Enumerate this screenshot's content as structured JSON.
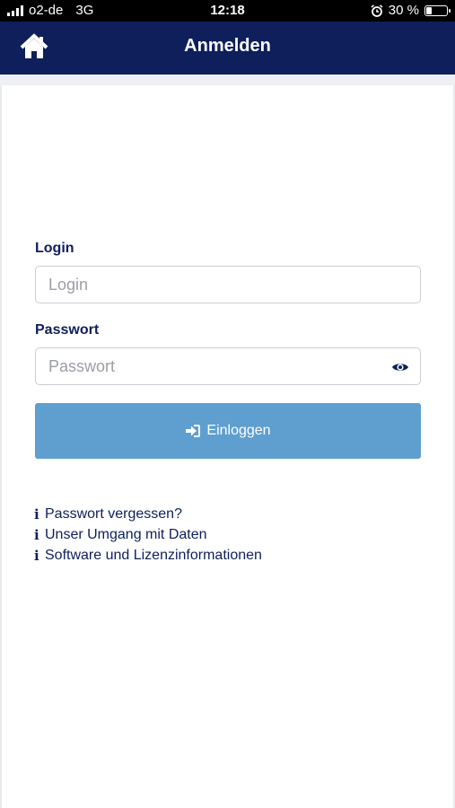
{
  "status_bar": {
    "carrier": "o2-de",
    "network": "3G",
    "time": "12:18",
    "battery": "30 %",
    "battery_level": 0.3
  },
  "header": {
    "title": "Anmelden",
    "home_icon": "home-icon",
    "color": "#0e1f5b"
  },
  "form": {
    "login_label": "Login",
    "login_placeholder": "Login",
    "password_label": "Passwort",
    "password_placeholder": "Passwort",
    "eye_icon": "eye-icon",
    "submit_label": "Einloggen",
    "submit_icon": "sign-in-icon",
    "submit_color": "#5e9fcf"
  },
  "links": [
    {
      "icon": "info-icon",
      "label": "Passwort vergessen?"
    },
    {
      "icon": "info-icon",
      "label": "Unser Umgang mit Daten"
    },
    {
      "icon": "info-icon",
      "label": "Software und Lizenzinformationen"
    }
  ]
}
